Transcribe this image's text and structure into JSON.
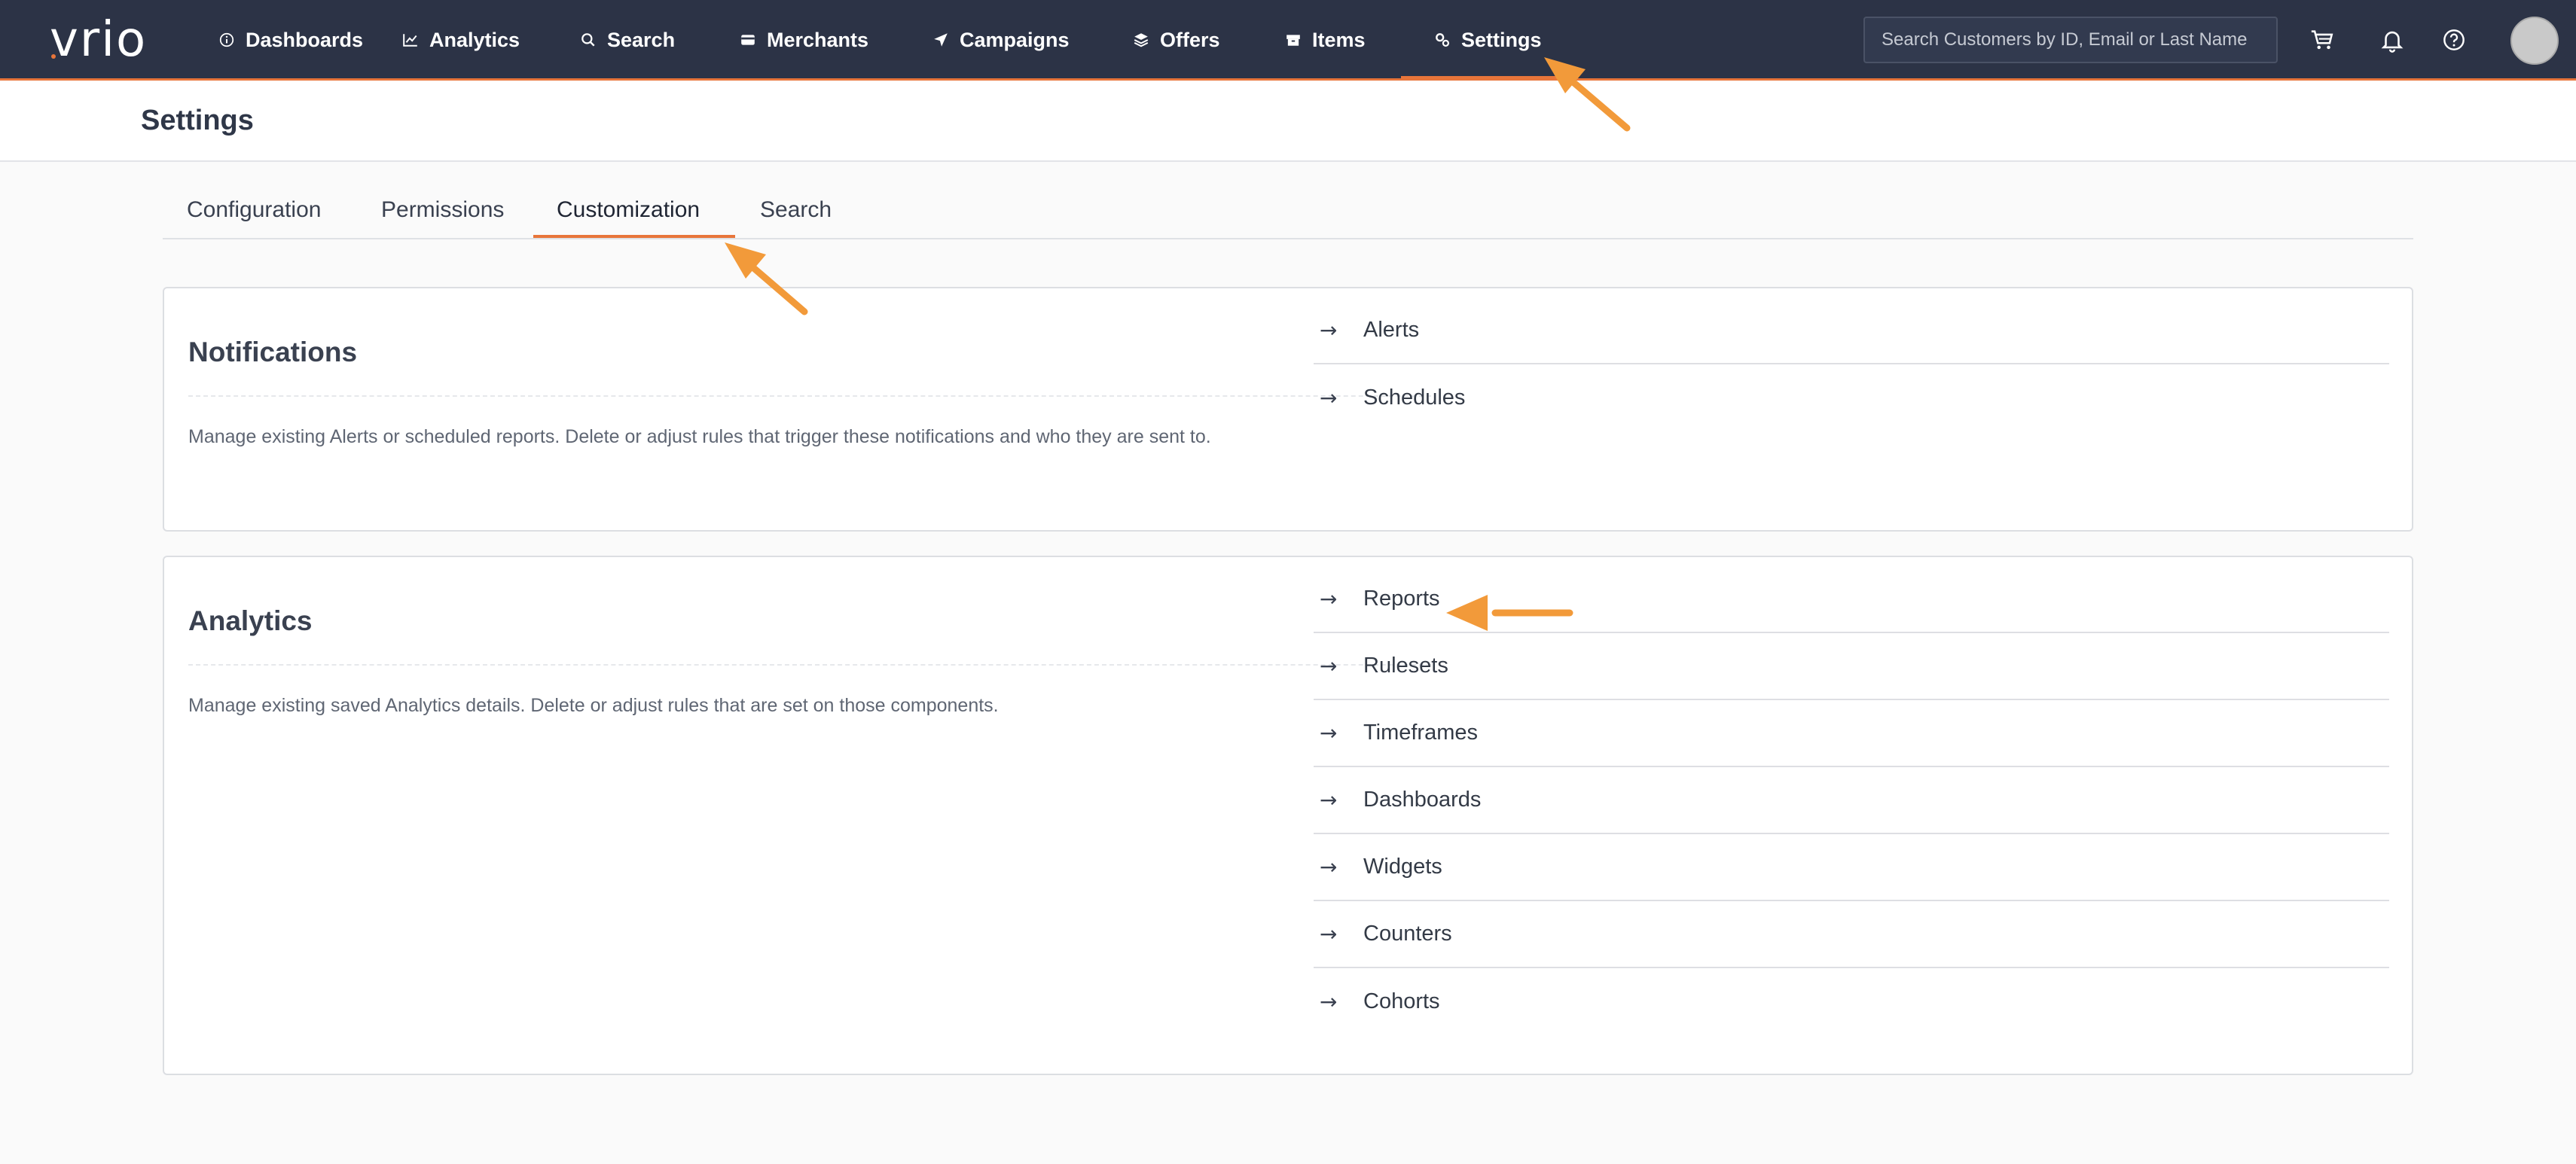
{
  "brand": {
    "logo_text": "vrio"
  },
  "nav": {
    "items": [
      {
        "label": "Dashboards",
        "icon": "info-circle-icon"
      },
      {
        "label": "Analytics",
        "icon": "line-chart-icon"
      },
      {
        "label": "Search",
        "icon": "search-icon"
      },
      {
        "label": "Merchants",
        "icon": "credit-card-icon"
      },
      {
        "label": "Campaigns",
        "icon": "paper-plane-icon"
      },
      {
        "label": "Offers",
        "icon": "layers-icon"
      },
      {
        "label": "Items",
        "icon": "box-icon"
      },
      {
        "label": "Settings",
        "icon": "gears-icon"
      }
    ],
    "active": "Settings",
    "search_placeholder": "Search Customers by ID, Email or Last Name",
    "right_icons": [
      "cart-icon",
      "bell-icon",
      "help-circle-icon",
      "avatar"
    ]
  },
  "page": {
    "title": "Settings"
  },
  "tabs": {
    "items": [
      {
        "label": "Configuration"
      },
      {
        "label": "Permissions"
      },
      {
        "label": "Customization"
      },
      {
        "label": "Search"
      }
    ],
    "active": "Customization"
  },
  "cards": [
    {
      "title": "Notifications",
      "description": "Manage existing Alerts or scheduled reports. Delete or adjust rules that trigger these notifications and who they are sent to.",
      "links": [
        {
          "label": "Alerts"
        },
        {
          "label": "Schedules"
        }
      ]
    },
    {
      "title": "Analytics",
      "description": "Manage existing saved Analytics details. Delete or adjust rules that are set on those components.",
      "links": [
        {
          "label": "Reports"
        },
        {
          "label": "Rulesets"
        },
        {
          "label": "Timeframes"
        },
        {
          "label": "Dashboards"
        },
        {
          "label": "Widgets"
        },
        {
          "label": "Counters"
        },
        {
          "label": "Cohorts"
        }
      ]
    }
  ],
  "colors": {
    "nav_bg": "#2c3346",
    "accent": "#e8753a",
    "annotation": "#f29a3a"
  },
  "link_arrow_glyph": "→"
}
